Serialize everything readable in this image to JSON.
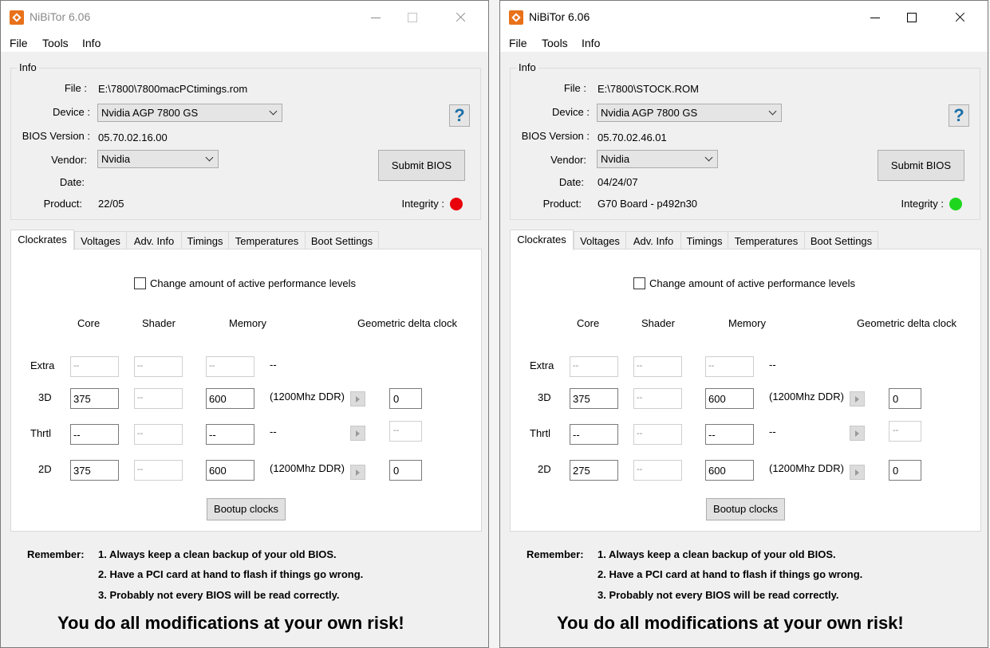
{
  "windows": [
    {
      "title": "NiBiTor 6.06",
      "active": false,
      "menu": [
        "File",
        "Tools",
        "Info"
      ],
      "info": {
        "group_title": "Info",
        "file_label": "File :",
        "file_value": "E:\\7800\\7800macPCtimings.rom",
        "device_label": "Device :",
        "device_value": "Nvidia AGP 7800 GS",
        "bios_label": "BIOS Version :",
        "bios_value": "05.70.02.16.00",
        "vendor_label": "Vendor:",
        "vendor_value": "Nvidia",
        "date_label": "Date:",
        "date_value": "",
        "product_label": "Product:",
        "product_value": "22/05",
        "help_label": "?",
        "submit_label": "Submit BIOS",
        "integrity_label": "Integrity :",
        "integrity_color": "#e8000b"
      },
      "tabs": [
        "Clockrates",
        "Voltages",
        "Adv. Info",
        "Timings",
        "Temperatures",
        "Boot Settings"
      ],
      "clockrates": {
        "change_label": "Change amount of active performance levels",
        "headers": {
          "core": "Core",
          "shader": "Shader",
          "memory": "Memory",
          "delta": "Geometric delta clock"
        },
        "rows": [
          {
            "label": "Extra",
            "core": "--",
            "shader": "--",
            "memory": "--",
            "note": "--",
            "delta": ""
          },
          {
            "label": "3D",
            "core": "375",
            "shader": "--",
            "memory": "600",
            "note": "(1200Mhz DDR)",
            "delta": "0"
          },
          {
            "label": "Thrtl",
            "core": "--",
            "shader": "--",
            "memory": "--",
            "note": "--",
            "delta": "--"
          },
          {
            "label": "2D",
            "core": "375",
            "shader": "--",
            "memory": "600",
            "note": "(1200Mhz DDR)",
            "delta": "0"
          }
        ],
        "bootup_label": "Bootup clocks"
      },
      "remember": {
        "label": "Remember:",
        "line1": "1. Always keep a clean backup of your old BIOS.",
        "line2": "2. Have a PCI card at hand to flash if things go wrong.",
        "line3": "3. Probably not every BIOS will be read correctly."
      },
      "risk": "You do all modifications at your own risk!"
    },
    {
      "title": "NiBiTor 6.06",
      "active": true,
      "menu": [
        "File",
        "Tools",
        "Info"
      ],
      "info": {
        "group_title": "Info",
        "file_label": "File :",
        "file_value": "E:\\7800\\STOCK.ROM",
        "device_label": "Device :",
        "device_value": "Nvidia AGP 7800 GS",
        "bios_label": "BIOS Version :",
        "bios_value": "05.70.02.46.01",
        "vendor_label": "Vendor:",
        "vendor_value": "Nvidia",
        "date_label": "Date:",
        "date_value": "04/24/07",
        "product_label": "Product:",
        "product_value": "G70 Board - p492n30",
        "help_label": "?",
        "submit_label": "Submit BIOS",
        "integrity_label": "Integrity :",
        "integrity_color": "#1fd61f"
      },
      "tabs": [
        "Clockrates",
        "Voltages",
        "Adv. Info",
        "Timings",
        "Temperatures",
        "Boot Settings"
      ],
      "clockrates": {
        "change_label": "Change amount of active performance levels",
        "headers": {
          "core": "Core",
          "shader": "Shader",
          "memory": "Memory",
          "delta": "Geometric delta clock"
        },
        "rows": [
          {
            "label": "Extra",
            "core": "--",
            "shader": "--",
            "memory": "--",
            "note": "--",
            "delta": ""
          },
          {
            "label": "3D",
            "core": "375",
            "shader": "--",
            "memory": "600",
            "note": "(1200Mhz DDR)",
            "delta": "0"
          },
          {
            "label": "Thrtl",
            "core": "--",
            "shader": "--",
            "memory": "--",
            "note": "--",
            "delta": "--"
          },
          {
            "label": "2D",
            "core": "275",
            "shader": "--",
            "memory": "600",
            "note": "(1200Mhz DDR)",
            "delta": "0"
          }
        ],
        "bootup_label": "Bootup clocks"
      },
      "remember": {
        "label": "Remember:",
        "line1": "1. Always keep a clean backup of your old BIOS.",
        "line2": "2. Have a PCI card at hand to flash if things go wrong.",
        "line3": "3. Probably not every BIOS will be read correctly."
      },
      "risk": "You do all modifications at your own risk!"
    }
  ]
}
